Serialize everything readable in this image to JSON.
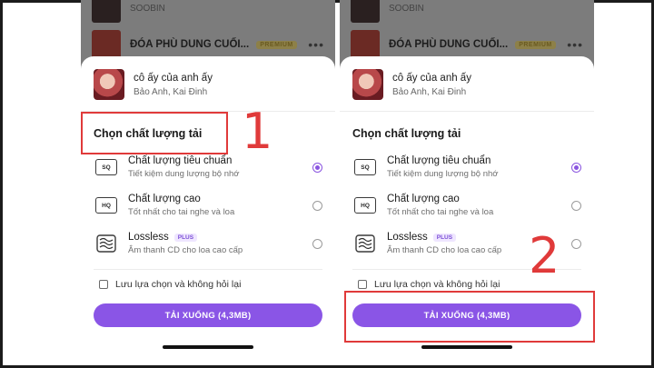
{
  "background_list": {
    "row1_artist": "SOOBIN",
    "row2_title": "ĐÓA PHÙ DUNG CUỐI...",
    "row2_badge": "PREMIUM",
    "more": "•••",
    "row2_sub": "...."
  },
  "song": {
    "title": "cô ấy của anh ấy",
    "artist": "Bảo Anh, Kai Đinh"
  },
  "section_title": "Chọn chất lượng tải",
  "options": [
    {
      "icon": "SQ",
      "label": "Chất lượng tiêu chuẩn",
      "desc": "Tiết kiệm dung lượng bộ nhớ",
      "selected": true
    },
    {
      "icon": "HQ",
      "label": "Chất lượng cao",
      "desc": "Tốt nhất cho tai nghe và loa",
      "selected": false
    },
    {
      "icon": "lossless-wave-icon",
      "label": "Lossless",
      "badge": "PLUS",
      "desc": "Âm thanh CD cho loa cao cấp",
      "selected": false
    }
  ],
  "remember_label": "Lưu lựa chọn và không hỏi lại",
  "download_label": "TẢI XUỐNG (4,3MB)",
  "steps": {
    "step1": "1",
    "step2": "2"
  },
  "colors": {
    "accent": "#8a55e6",
    "annotation": "#e03a3a"
  }
}
